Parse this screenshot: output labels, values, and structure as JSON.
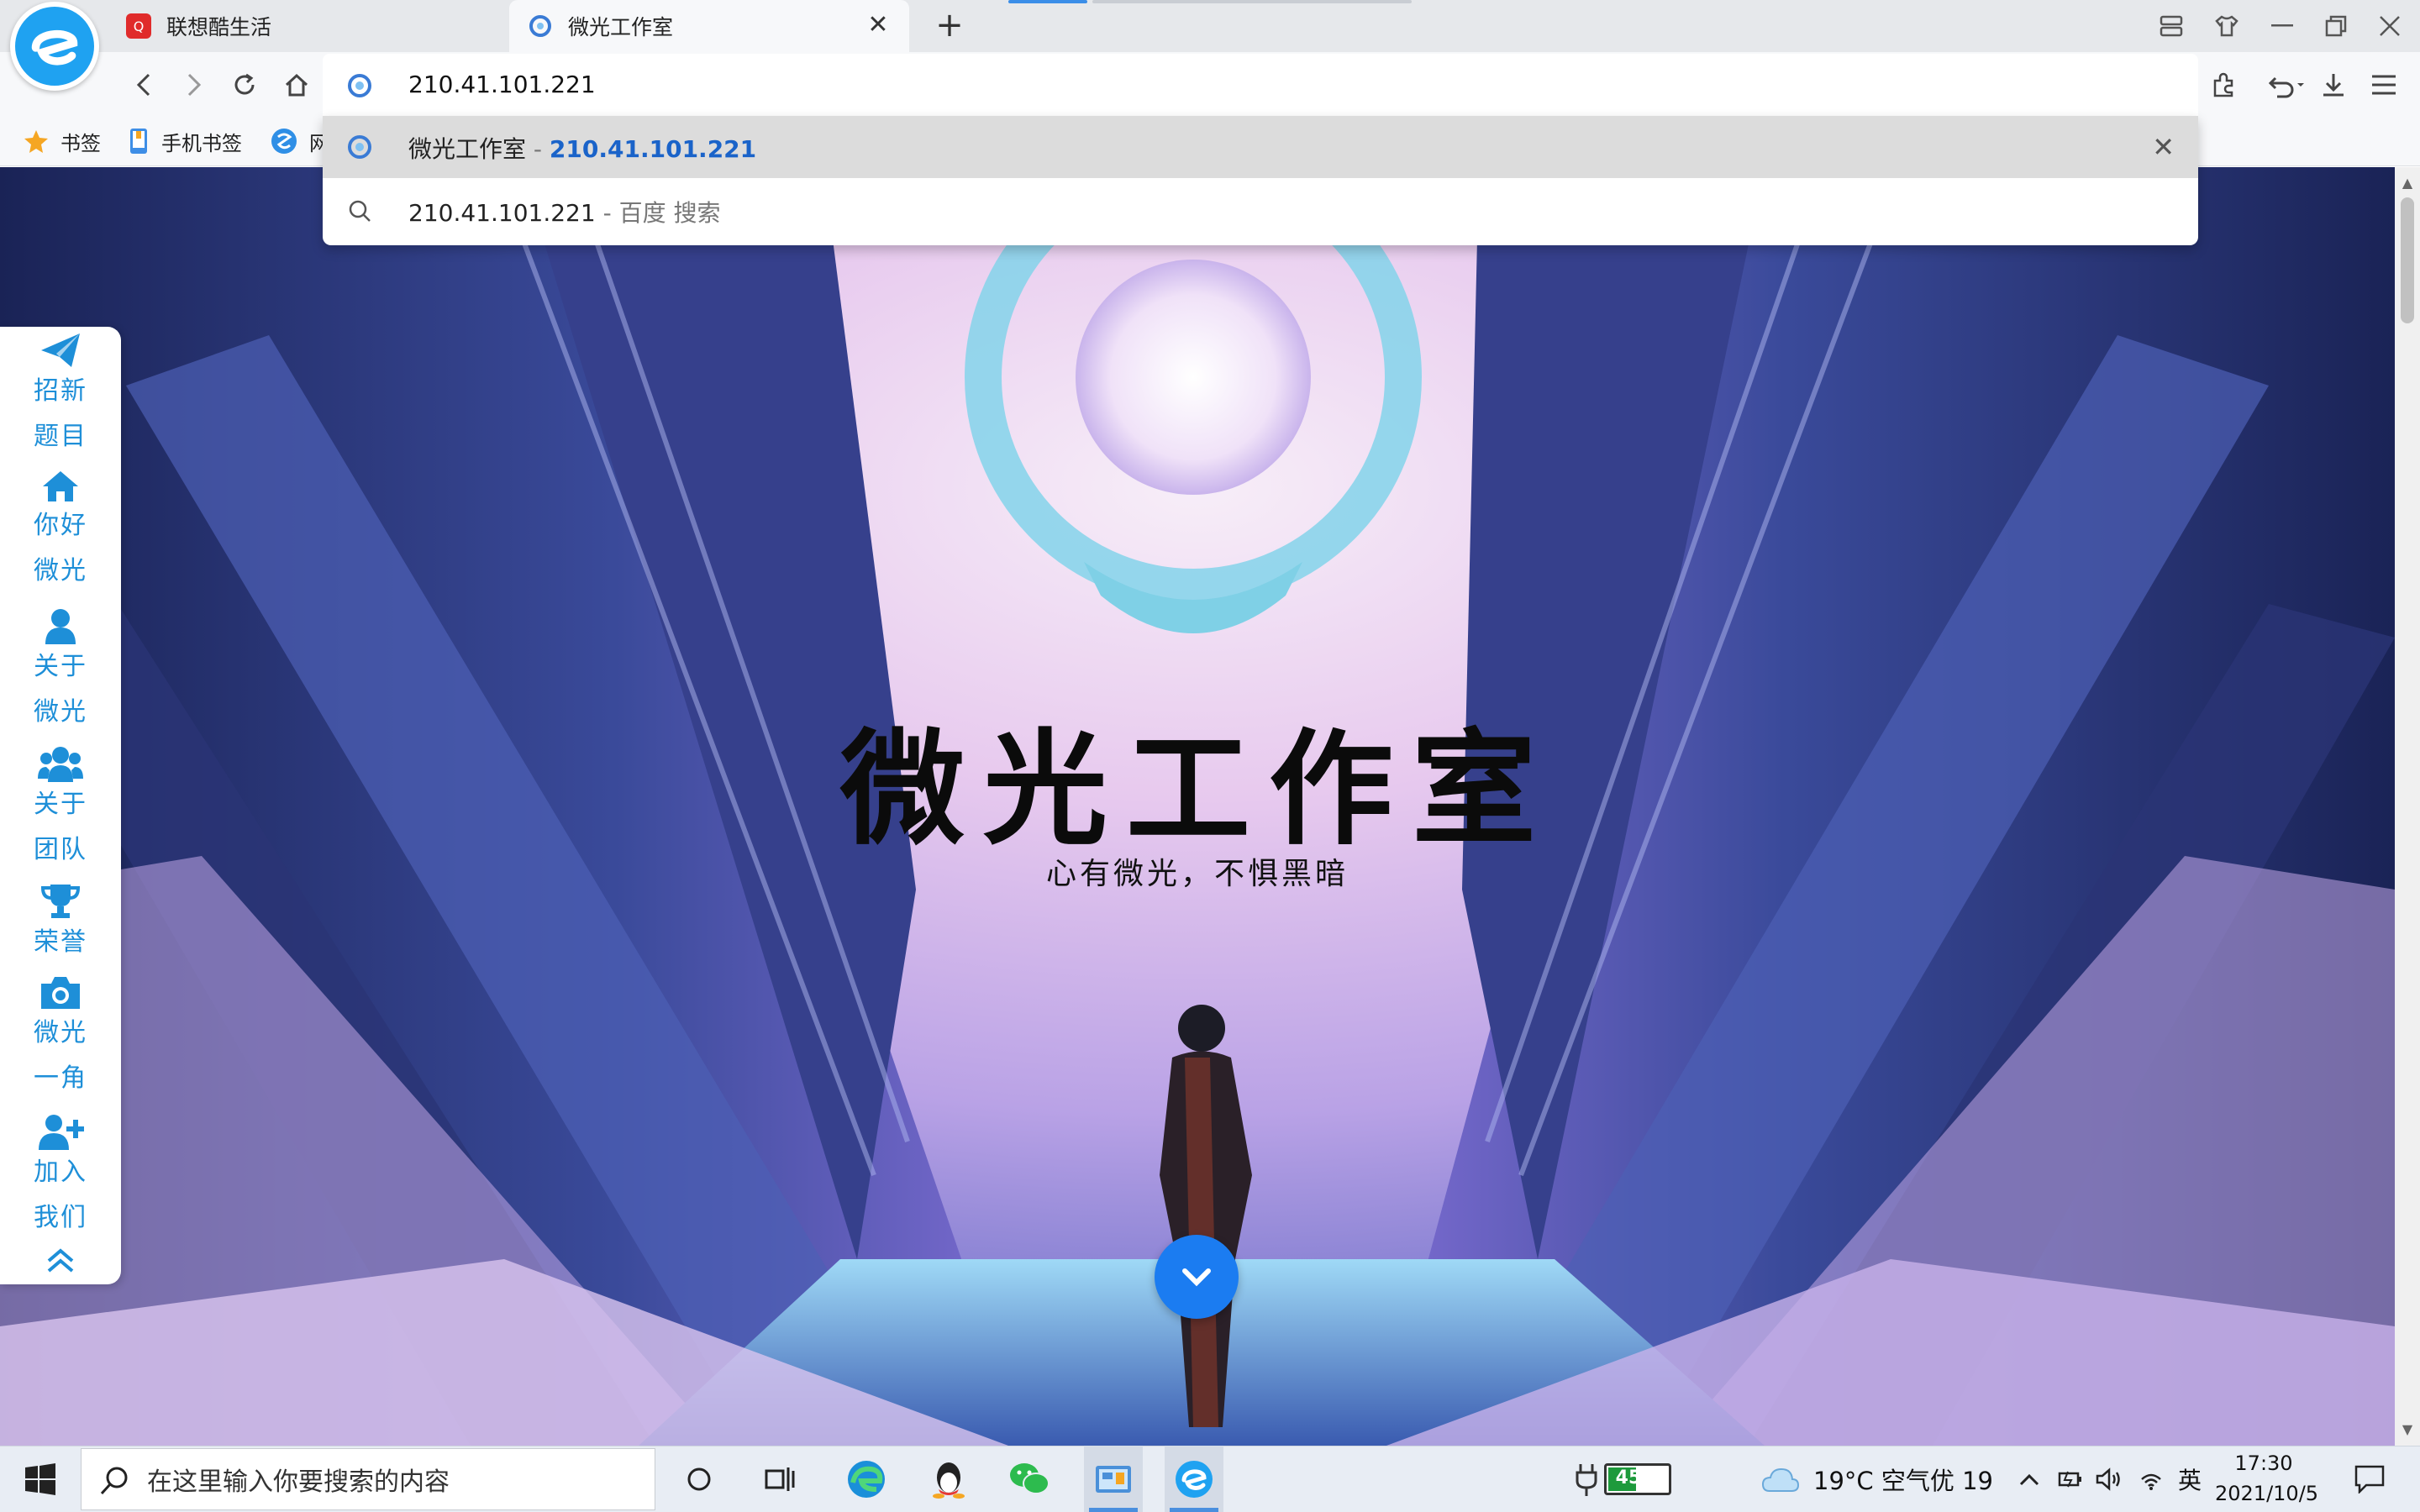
{
  "browser": {
    "tabs": [
      {
        "label": "联想酷生活"
      },
      {
        "label": "微光工作室",
        "close": "✕"
      }
    ],
    "new_tab": "+",
    "address": "210.41.101.221",
    "suggestions": [
      {
        "title": "微光工作室",
        "sep": " - ",
        "url": "210.41.101.221",
        "delete": "✕"
      },
      {
        "query": "210.41.101.221",
        "sep": " - ",
        "engine": "百度 搜索"
      }
    ],
    "bookmarks": [
      {
        "label": "书签"
      },
      {
        "label": "手机书签"
      },
      {
        "label": "网"
      }
    ]
  },
  "page": {
    "title": "微光工作室",
    "subtitle": "心有微光，不惧黑暗",
    "nav": [
      {
        "line1": "招新",
        "line2": "题目",
        "icon": "paper-plane-icon"
      },
      {
        "line1": "你好",
        "line2": "微光",
        "icon": "home-icon"
      },
      {
        "line1": "关于",
        "line2": "微光",
        "icon": "user-icon"
      },
      {
        "line1": "关于",
        "line2": "团队",
        "icon": "users-icon"
      },
      {
        "line1": "荣誉",
        "line2": "",
        "icon": "trophy-icon"
      },
      {
        "line1": "微光",
        "line2": "一角",
        "icon": "camera-icon"
      },
      {
        "line1": "加入",
        "line2": "我们",
        "icon": "user-plus-icon"
      }
    ]
  },
  "taskbar": {
    "search_placeholder": "在这里输入你要搜索的内容",
    "battery": "45%",
    "weather": "19°C 空气优 19",
    "ime": "英",
    "time": "17:30",
    "date": "2021/10/5"
  },
  "colors": {
    "accent": "#1b7cf1",
    "nav": "#1e8fd8",
    "link": "#1a63c9"
  }
}
